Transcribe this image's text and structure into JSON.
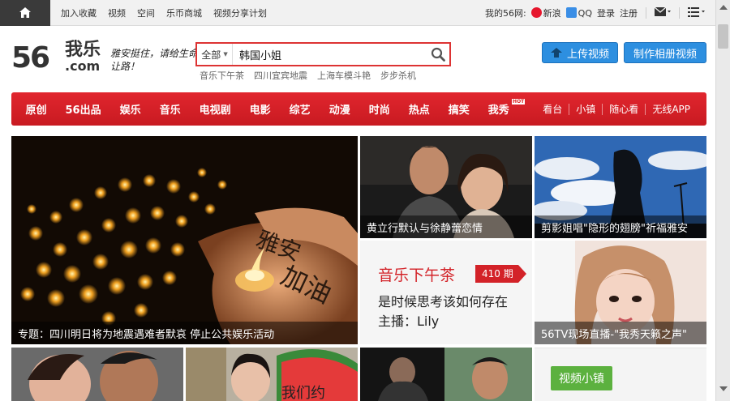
{
  "topbar": {
    "links": [
      "加入收藏",
      "视频",
      "空间",
      "乐币商城",
      "视频分享计划"
    ],
    "my56": "我的56网:",
    "sina": "新浪",
    "qq": "QQ",
    "login": "登录",
    "register": "注册"
  },
  "header": {
    "logo_56": "56",
    "logo_wl": "我乐",
    "logo_com": ".com",
    "slogan": "雅安挺住，请给生命让路！",
    "search": {
      "category": "全部",
      "query": "韩国小姐",
      "hotwords": [
        "音乐下午茶",
        "四川宜宾地震",
        "上海车模斗艳",
        "步步杀机"
      ]
    },
    "upload_label": "上传视频",
    "album_label": "制作相册视频"
  },
  "nav": {
    "items": [
      "原创",
      "56出品",
      "娱乐",
      "音乐",
      "电视剧",
      "电影",
      "综艺",
      "动漫",
      "时尚",
      "热点",
      "搞笑",
      "我秀"
    ],
    "hot_badge": "HOT",
    "right_items": [
      "看台",
      "小镇",
      "随心看",
      "无线APP"
    ]
  },
  "tiles": {
    "main_caption": "专题：四川明日将为地震遇难者默哀 停止公共娱乐活动",
    "tile2_caption": "黄立行默认与徐静蕾恋情",
    "tile3_caption": "剪影姐唱\"隐形的翅膀\"祈福雅安",
    "promo": {
      "title": "音乐下午茶",
      "issue": "410 期",
      "line1": "是时候思考该如何存在",
      "line2": "主播：Lily"
    },
    "tile5_caption": "56TV现场直播-\"我秀天籁之声\"",
    "xiaozhen_label": "视频小镇",
    "bottom_text": "我们约"
  },
  "colors": {
    "nav_red": "#d32228",
    "button_blue": "#2d8fe0",
    "xiaozhen_green": "#5cb13f"
  }
}
